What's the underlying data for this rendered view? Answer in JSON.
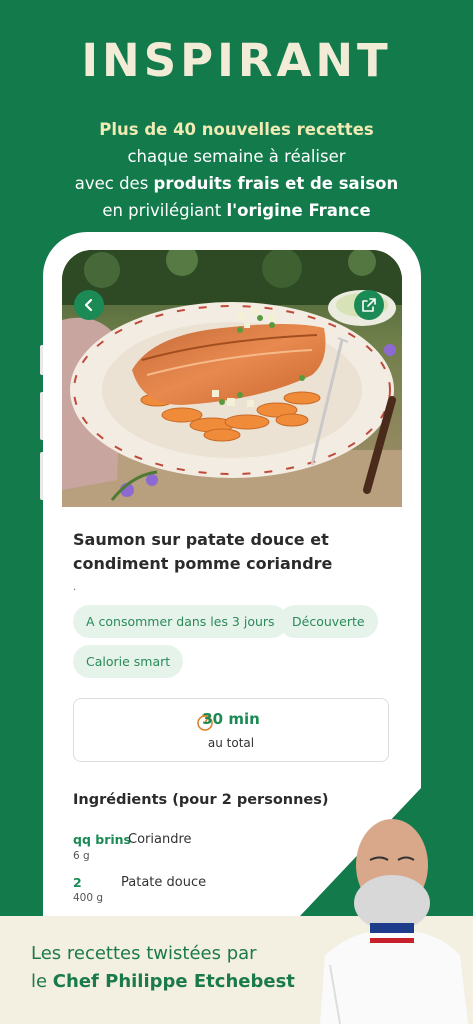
{
  "headline": "INSPIRANT",
  "subtitle": {
    "line1": "Plus de 40 nouvelles recettes",
    "line2": "chaque semaine à réaliser",
    "line3_a": "avec des ",
    "line3_b": "produits frais et de saison",
    "line4_a": "en privilégiant ",
    "line4_b": "l'origine France"
  },
  "recipe": {
    "title": "Saumon sur patate douce et condiment pomme coriandre",
    "dot": ".",
    "tags": [
      "A consommer dans les 3 jours",
      "Découverte",
      "Calorie smart"
    ],
    "time_value": "30 min",
    "time_label": "au total",
    "ingredients_title": "Ingrédients (pour 2 personnes)",
    "ingredients": [
      {
        "qty": "qq brins",
        "sub": "6 g",
        "name": "Coriandre"
      },
      {
        "qty": "2",
        "sub": "400 g",
        "name": "Patate douce"
      }
    ]
  },
  "footer": {
    "line1": "Les recettes twistées par",
    "line2_a": "le ",
    "line2_b": "Chef Philippe Etchebest"
  },
  "colors": {
    "background": "#137a4c",
    "accent": "#1b8a55",
    "tag_bg": "#e6f3ea",
    "band": "#f3efe1"
  },
  "icons": {
    "back": "chevron-left-icon",
    "share": "external-link-icon",
    "timer": "timer-icon"
  }
}
